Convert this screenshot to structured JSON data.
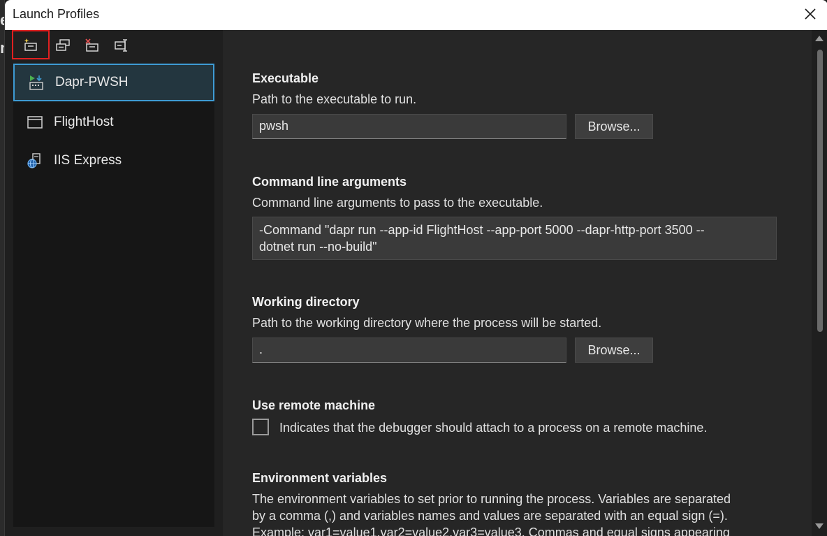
{
  "window": {
    "title": "Launch Profiles"
  },
  "toolbar": {
    "buttons": [
      {
        "icon": "new-profile-icon",
        "highlighted": true
      },
      {
        "icon": "copy-profile-icon"
      },
      {
        "icon": "delete-profile-icon"
      },
      {
        "icon": "rename-profile-icon"
      }
    ]
  },
  "profiles": [
    {
      "label": "Dapr-PWSH",
      "icon": "executable-icon",
      "selected": true
    },
    {
      "label": "FlightHost",
      "icon": "window-icon",
      "selected": false
    },
    {
      "label": "IIS Express",
      "icon": "globe-server-icon",
      "selected": false
    }
  ],
  "executable": {
    "title": "Executable",
    "description": "Path to the executable to run.",
    "value": "pwsh",
    "browse_label": "Browse..."
  },
  "arguments": {
    "title": "Command line arguments",
    "description": "Command line arguments to pass to the executable.",
    "line1": "-Command \"dapr run --app-id FlightHost --app-port 5000 --dapr-http-port 3500 --",
    "line2": "dotnet run --no-build\""
  },
  "working_directory": {
    "title": "Working directory",
    "description": "Path to the working directory where the process will be started.",
    "value": ".",
    "browse_label": "Browse..."
  },
  "remote": {
    "title": "Use remote machine",
    "checkbox_label": "Indicates that the debugger should attach to a process on a remote machine.",
    "checked": false
  },
  "environment": {
    "title": "Environment variables",
    "line1": "The environment variables to set prior to running the process. Variables are separated",
    "line2": "by a comma (,) and variables names and values are separated with an equal sign (=).",
    "line3": "Example: var1=value1,var2=value2,var3=value3. Commas and equal signs appearing"
  },
  "colors": {
    "accent": "#3e9bd4",
    "highlight": "#e02020"
  }
}
